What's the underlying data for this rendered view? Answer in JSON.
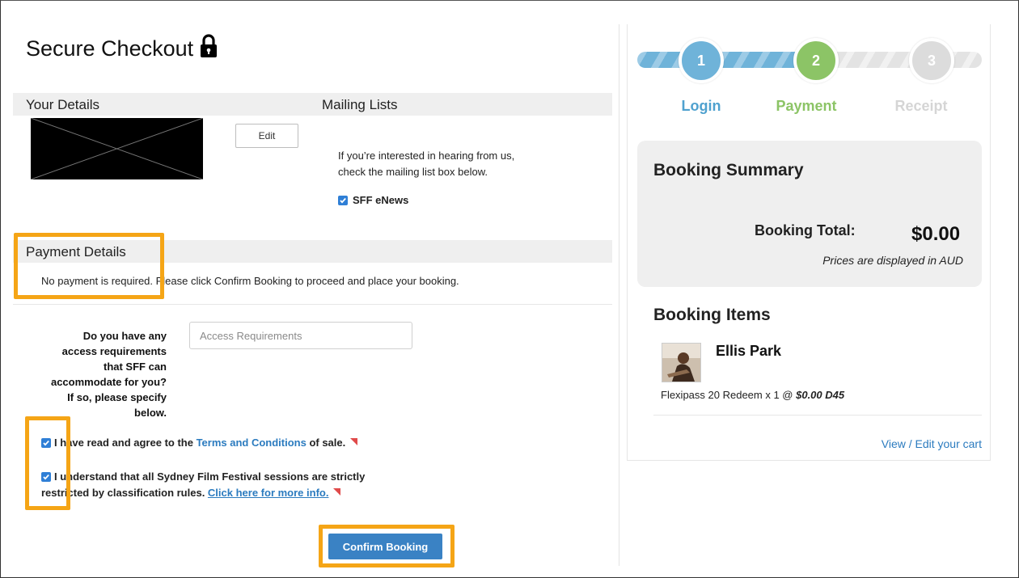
{
  "checkout": {
    "title": "Secure Checkout",
    "your_details_label": "Your Details",
    "mailing_lists_label": "Mailing Lists",
    "edit_label": "Edit",
    "mailing_text_line1": "If you’re interested in hearing from us,",
    "mailing_text_line2": "check the mailing list box below.",
    "enews_label": "SFF eNews",
    "payment_details_label": "Payment Details",
    "payment_note": "No payment is required. Please click Confirm Booking to proceed and place your booking.",
    "access_question_lines": [
      "Do you have any",
      "access requirements",
      "that SFF can",
      "accommodate for you?",
      "If so, please specify",
      "below."
    ],
    "access_placeholder": "Access Requirements",
    "terms_prefix": "I have read and agree to the ",
    "terms_link": "Terms and Conditions",
    "terms_suffix": " of sale.",
    "classif_line1": "I understand that all Sydney Film Festival sessions are strictly",
    "classif_line2_prefix": "restricted by classification rules. ",
    "classif_link": "Click here for more info.",
    "confirm_label": "Confirm Booking"
  },
  "steps": [
    {
      "number": "1",
      "label": "Login",
      "color": "#6fb3d9"
    },
    {
      "number": "2",
      "label": "Payment",
      "color": "#8cc466"
    },
    {
      "number": "3",
      "label": "Receipt",
      "color": "#dcdcdc"
    }
  ],
  "summary": {
    "title": "Booking Summary",
    "total_label": "Booking Total:",
    "total_value": "$0.00",
    "currency_note": "Prices are displayed in AUD"
  },
  "items": {
    "title": "Booking Items",
    "item_title": "Ellis Park",
    "item_line_prefix": "Flexipass 20 Redeem x 1 @ ",
    "item_price": "$0.00 D45",
    "view_edit_label": "View / Edit your cart"
  },
  "colors": {
    "accent_blue": "#3a82c4",
    "highlight_orange": "#f5a516",
    "checkbox_blue": "#2f7fd6"
  }
}
